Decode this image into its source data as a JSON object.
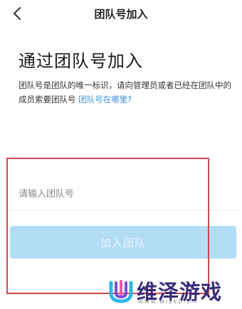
{
  "nav": {
    "title": "团队号加入"
  },
  "main": {
    "title": "通过团队号加入",
    "description": "团队号是团队的唯一标识，请向管理员或者已经在团队中的成员索要团队号",
    "description_link": "团队号在哪里?"
  },
  "form": {
    "team_input": {
      "placeholder": "请输入团队号",
      "value": ""
    },
    "join_button_label": "加入团队",
    "join_button_color": "#b3dcf5"
  },
  "overlay": {
    "highlight_color": "#cf4a4f"
  },
  "watermark": {
    "text": "维泽游戏",
    "subtext": "WWW.WIZED.VIP"
  }
}
